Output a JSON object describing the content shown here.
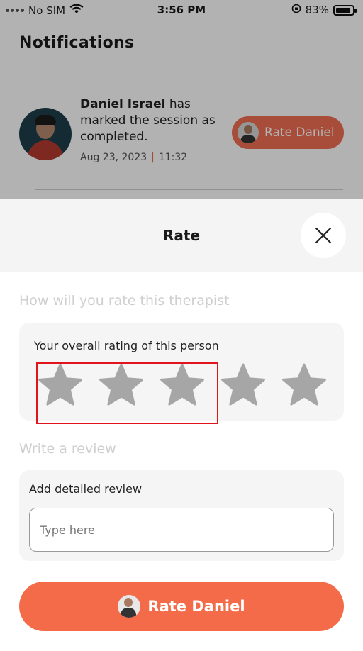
{
  "status_bar": {
    "carrier": "No SIM",
    "time": "3:56 PM",
    "battery": "83%"
  },
  "notifications": {
    "title": "Notifications",
    "item": {
      "name": "Daniel Israel",
      "message": "has marked the session as completed.",
      "date": "Aug 23, 2023",
      "separator": "|",
      "time": "11:32",
      "action_label": "Rate Daniel"
    }
  },
  "sheet": {
    "title": "Rate",
    "rating_section_label": "How will you rate this therapist",
    "rating_card_label": "Your overall rating of this person",
    "rating": {
      "value": 0,
      "max": 5
    },
    "review_section_label": "Write a review",
    "review_card_label": "Add detailed review",
    "review_placeholder": "Type here",
    "submit_label": "Rate Daniel"
  },
  "colors": {
    "accent": "#f46b49",
    "star_empty": "#a6a6a6",
    "highlight": "#e1141b"
  },
  "icons": [
    "wifi-icon",
    "lock-rotation-icon",
    "battery-icon",
    "close-icon",
    "star-icon",
    "avatar"
  ]
}
